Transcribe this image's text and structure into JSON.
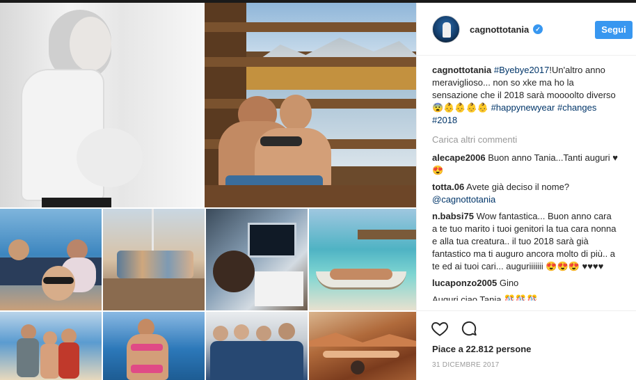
{
  "post": {
    "username": "cagnottotania",
    "verified_icon": "check-badge-icon",
    "follow_label": "Segui",
    "caption": {
      "username": "cagnottotania",
      "hashtag1": "#Byebye2017",
      "text1": "!Un'altro anno meraviglioso... non so xke ma ho la sensazione che il 2018 sarà moooolto diverso😨👶👶👶👶",
      "hashtag2": "#happynewyear",
      "hashtag3": "#changes",
      "hashtag4": "#2018"
    },
    "load_more_label": "Carica altri commenti",
    "comments": [
      {
        "user": "alecape2006",
        "text": "Buon anno Tania...Tanti auguri ♥😍"
      },
      {
        "user": "totta.06",
        "text": "Avete già deciso il nome?",
        "mention": "@cagnottotania"
      },
      {
        "user": "n.babsi75",
        "text": "Wow fantastica... Buon anno cara a te tuo marito i tuoi genitori la tua cara nonna e alla tua creatura.. il tuo 2018 sarà già fantastico ma ti auguro ancora molto di più.. a te ed ai tuoi cari... auguriiiiiii 😍😍😍 ♥♥♥♥"
      },
      {
        "user": "lucaponzo2005",
        "text": "Gino"
      },
      {
        "user": "",
        "text": "Auguri ciao Tania 🎊🎊🎊"
      }
    ],
    "likes_text": "Piace a 22.812 persone",
    "date_text": "31 DICEMBRE 2017",
    "colors": {
      "accent": "#3897f0",
      "link": "#003569",
      "muted": "#999999"
    }
  }
}
